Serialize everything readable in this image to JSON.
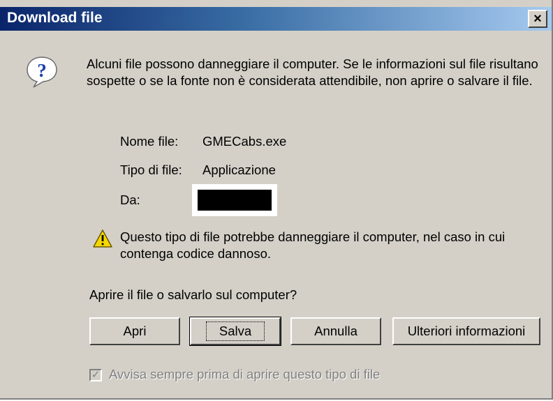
{
  "window": {
    "title": "Download file"
  },
  "controls": {
    "close_glyph": "×"
  },
  "message": "Alcuni file possono danneggiare il computer. Se le informazioni sul file risultano sospette o se la fonte non è considerata attendibile, non aprire o salvare il file.",
  "file_info": {
    "name_label": "Nome file:",
    "name_value": "GMECabs.exe",
    "type_label": "Tipo di file:",
    "type_value": "Applicazione",
    "from_label": "Da:"
  },
  "warning": "Questo tipo di file potrebbe danneggiare il computer, nel caso in cui contenga codice dannoso.",
  "question": "Aprire il file o salvarlo sul computer?",
  "buttons": {
    "open": "Apri",
    "save": "Salva",
    "cancel": "Annulla",
    "more_info": "Ulteriori informazioni"
  },
  "checkbox": {
    "label": "Avvisa sempre prima di aprire questo tipo di file",
    "checked": true,
    "disabled": true
  },
  "icons": {
    "dialog": "question-icon",
    "warning": "warning-icon"
  }
}
